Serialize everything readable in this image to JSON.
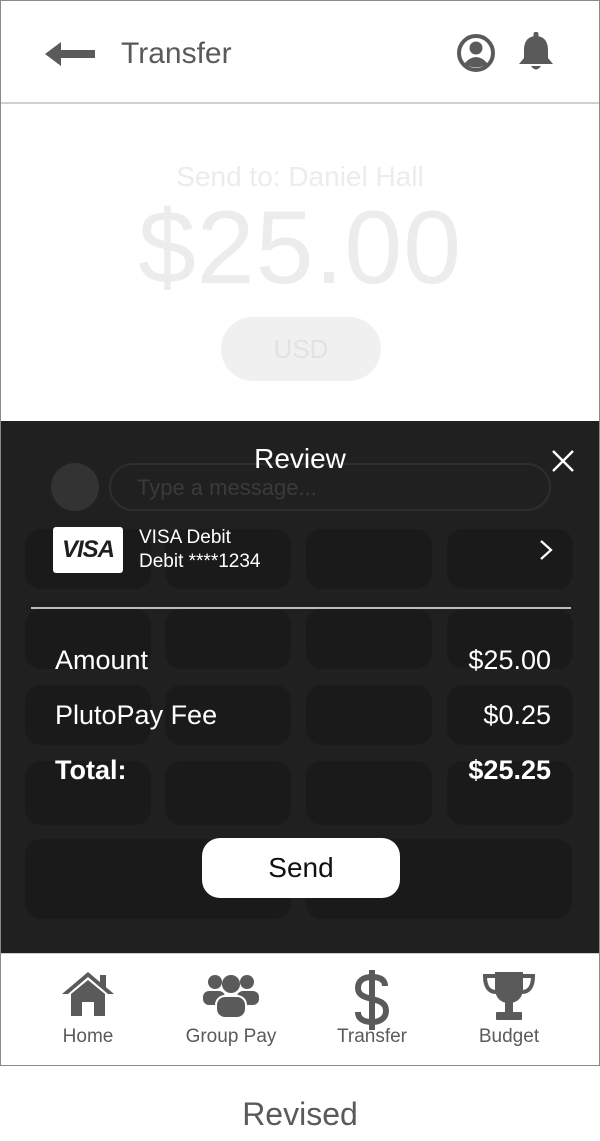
{
  "header": {
    "title": "Transfer"
  },
  "transfer": {
    "send_to": "Send to: Daniel Hall",
    "amount": "$25.00",
    "currency": "USD",
    "message_placeholder": "Type a message..."
  },
  "review": {
    "title": "Review",
    "card": {
      "brand": "VISA",
      "name": "VISA Debit",
      "number": "Debit ****1234"
    },
    "rows": [
      {
        "label": "Amount",
        "value": "$25.00"
      },
      {
        "label": "PlutoPay Fee",
        "value": "$0.25"
      },
      {
        "label": "Total:",
        "value": "$25.25"
      }
    ],
    "send_label": "Send"
  },
  "nav": {
    "items": [
      {
        "label": "Home",
        "icon": "home-icon"
      },
      {
        "label": "Group Pay",
        "icon": "group-icon"
      },
      {
        "label": "Transfer",
        "icon": "dollar-icon"
      },
      {
        "label": "Budget",
        "icon": "trophy-icon"
      }
    ]
  },
  "caption": "Revised",
  "colors": {
    "sheet_bg": "#202020",
    "text_gray": "#5a5a5a",
    "white": "#ffffff"
  }
}
